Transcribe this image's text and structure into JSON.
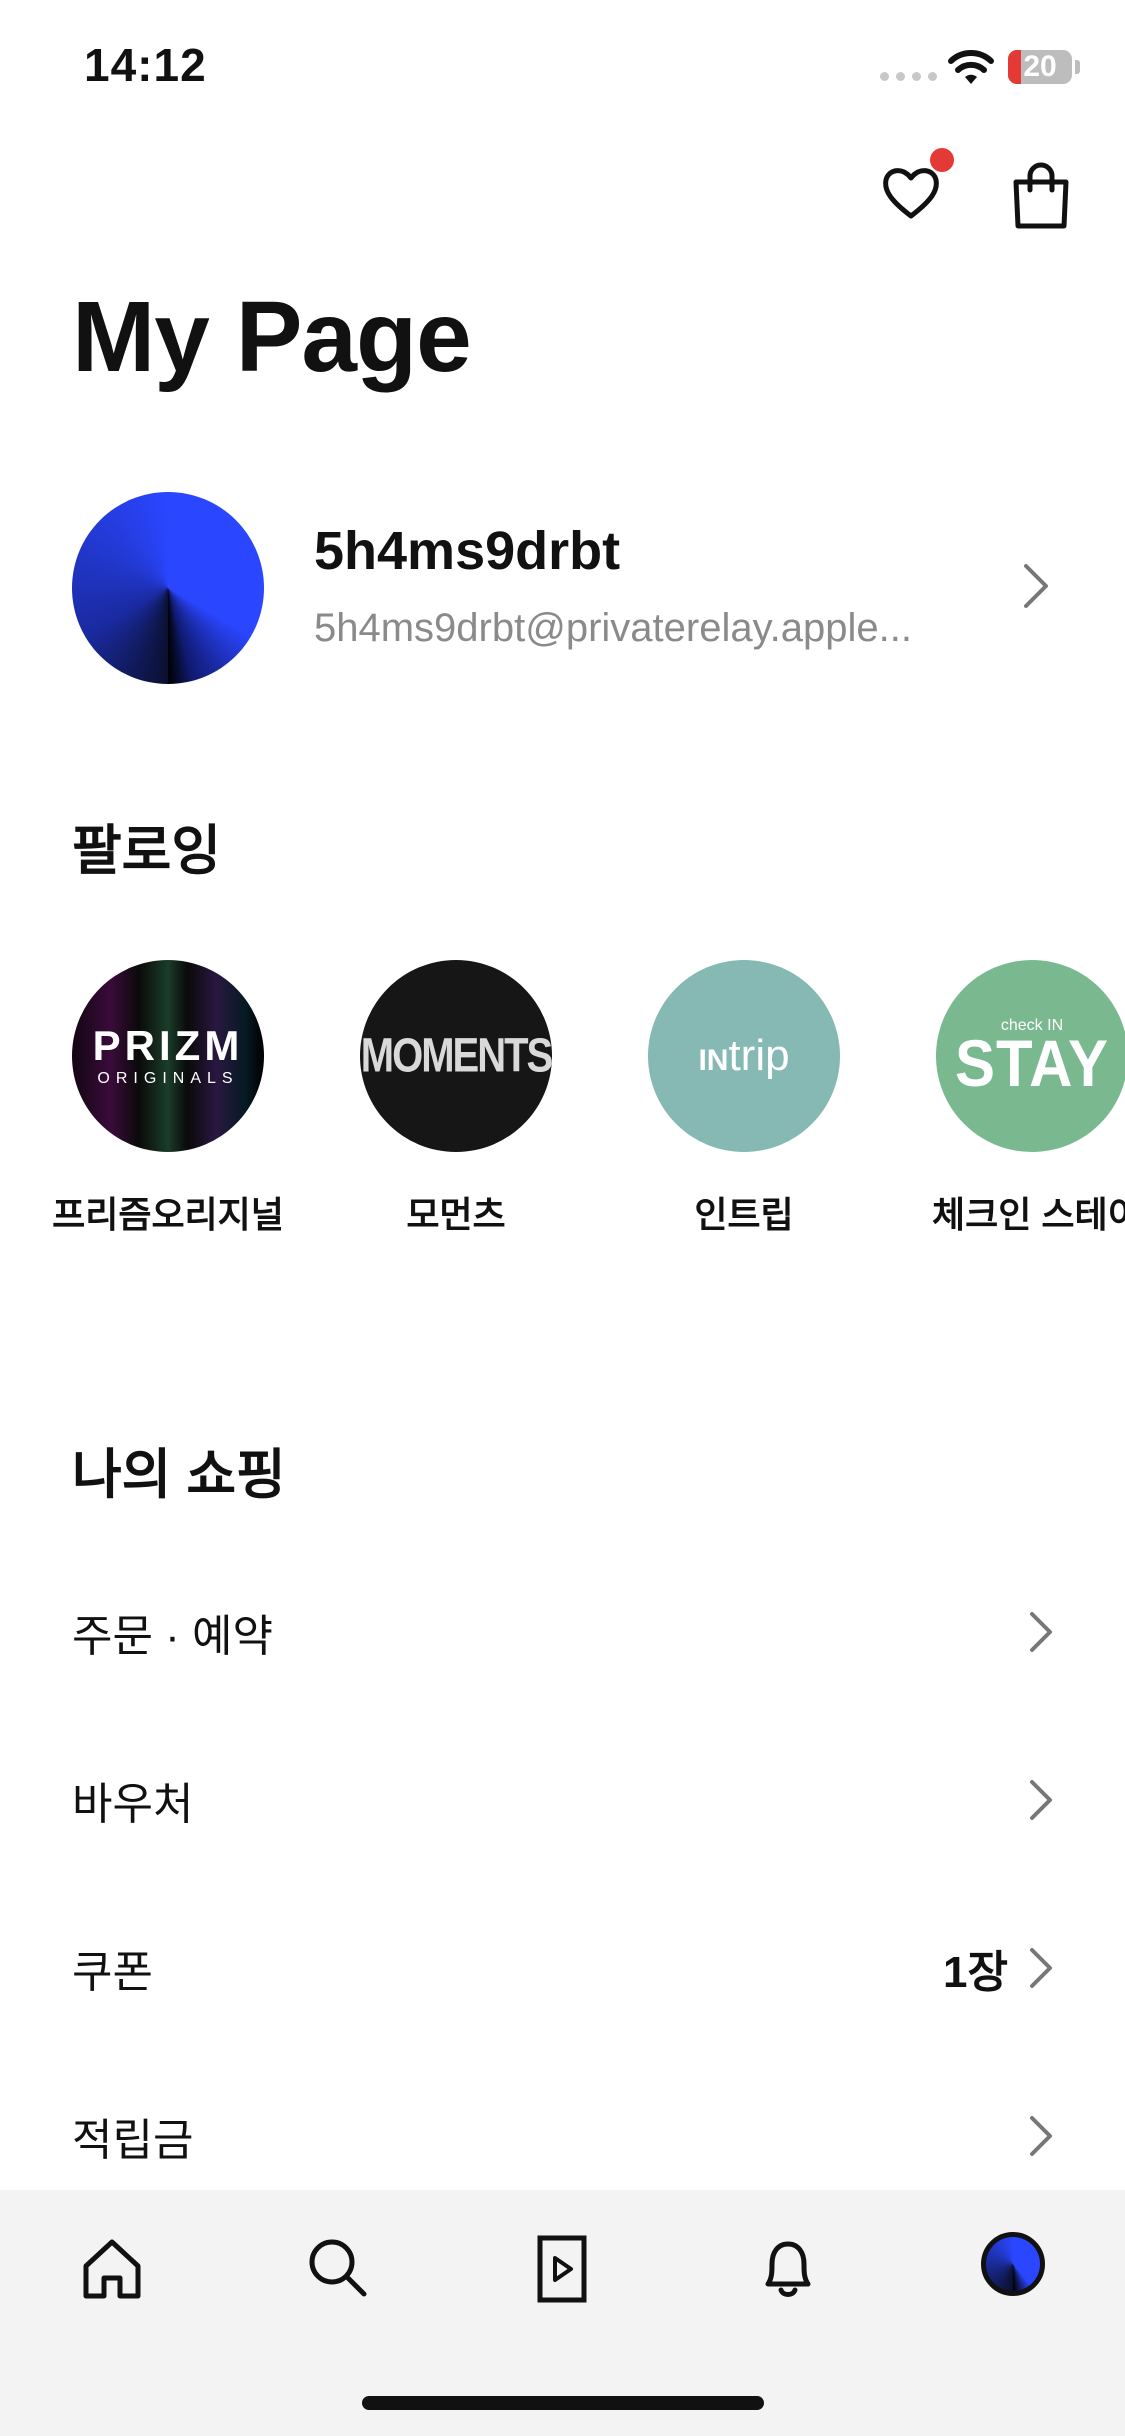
{
  "status_bar": {
    "time": "14:12",
    "battery": "20"
  },
  "header": {
    "title": "My Page",
    "wishlist_has_notification": true
  },
  "profile": {
    "name": "5h4ms9drbt",
    "email": "5h4ms9drbt@privaterelay.apple..."
  },
  "following": {
    "title": "팔로잉",
    "items": [
      {
        "label": "프리즘오리지널",
        "logo_main": "PRIZM",
        "logo_sub": "ORIGINALS"
      },
      {
        "label": "모먼츠",
        "logo_main": "MOMENTS"
      },
      {
        "label": "인트립",
        "logo_main": "trip",
        "logo_prefix": "IN"
      },
      {
        "label": "체크인 스테이",
        "logo_main": "STAY",
        "logo_sub": "check IN"
      }
    ]
  },
  "shopping": {
    "title": "나의 쇼핑",
    "items": [
      {
        "label": "주문 · 예약",
        "value": ""
      },
      {
        "label": "바우처",
        "value": ""
      },
      {
        "label": "쿠폰",
        "value": "1장"
      },
      {
        "label": "적립금",
        "value": ""
      }
    ]
  },
  "tabbar": {
    "items": [
      {
        "name": "home-icon"
      },
      {
        "name": "search-icon"
      },
      {
        "name": "video-play-icon"
      },
      {
        "name": "bell-icon"
      },
      {
        "name": "profile-avatar"
      }
    ]
  },
  "colors": {
    "notification_dot": "#e53935",
    "accent_blue": "#2a46ff"
  }
}
